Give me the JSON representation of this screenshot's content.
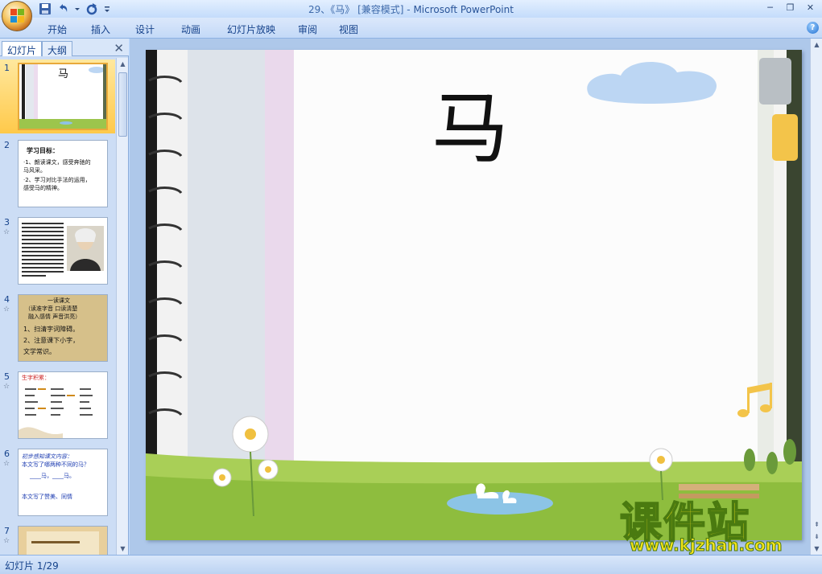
{
  "window": {
    "title_prefix": "29、《马》 [兼容模式] - ",
    "title_app": "Microsoft PowerPoint",
    "minimize": "─",
    "restore": "❐",
    "close": "✕"
  },
  "ribbon": {
    "tabs": [
      {
        "label": "开始"
      },
      {
        "label": "插入"
      },
      {
        "label": "设计"
      },
      {
        "label": "动画"
      },
      {
        "label": "幻灯片放映"
      },
      {
        "label": "审阅"
      },
      {
        "label": "视图"
      }
    ],
    "help": "?"
  },
  "left_pane": {
    "tab_slides": "幻灯片",
    "tab_outline": "大纲",
    "close": "✕",
    "thumbnails": [
      {
        "num": "1",
        "title": "马"
      },
      {
        "num": "2",
        "star": "☆",
        "lines": [
          "学习目标：",
          "·1、朗读课文，感受奔驰的",
          "  马风采。",
          "·2、学习对比手法的运用，",
          "  感受马的精神。"
        ]
      },
      {
        "num": "3",
        "star": "☆"
      },
      {
        "num": "4",
        "star": "☆",
        "lines": [
          "一读课文",
          "（读准字音  口读清楚",
          "融入感情 声音洪亮）",
          "1、扫清字词障碍。",
          "2、注意课下小字，",
          "文学常识。"
        ]
      },
      {
        "num": "5",
        "star": "☆",
        "lines": [
          "生字积累："
        ]
      },
      {
        "num": "6",
        "star": "☆",
        "lines": [
          "初步感知课文内容：",
          "本文写了哪两种不同的马？",
          "____马，____马。",
          "本文写了赞美、同情"
        ]
      },
      {
        "num": "7",
        "star": "☆"
      }
    ]
  },
  "slide": {
    "title": "马"
  },
  "watermark": {
    "brand": "课件站",
    "url": "www.kjzhan.com"
  },
  "status": {
    "slide_indicator": "幻灯片 1/29"
  }
}
